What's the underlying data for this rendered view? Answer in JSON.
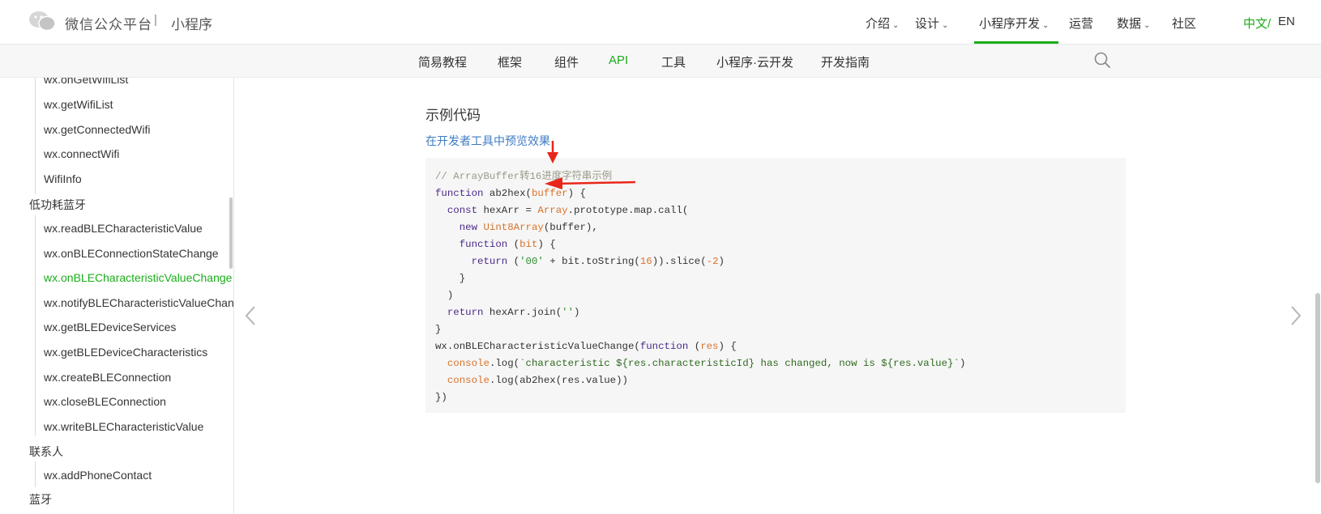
{
  "header": {
    "brand": "微信公众平台",
    "separator": "|",
    "sub": "小程序",
    "nav": [
      {
        "label": "介绍",
        "has_dropdown": true
      },
      {
        "label": "设计",
        "has_dropdown": true
      },
      {
        "label": "小程序开发",
        "has_dropdown": true,
        "active": true
      },
      {
        "label": "运营",
        "has_dropdown": false
      },
      {
        "label": "数据",
        "has_dropdown": true
      },
      {
        "label": "社区",
        "has_dropdown": false
      }
    ],
    "lang_zh": "中文/",
    "lang_en": "EN",
    "accent": "#1aad19"
  },
  "subnav": {
    "items": [
      {
        "label": "简易教程"
      },
      {
        "label": "框架"
      },
      {
        "label": "组件"
      },
      {
        "label": "API",
        "active": true
      },
      {
        "label": "工具"
      },
      {
        "label": "小程序·云开发"
      },
      {
        "label": "开发指南"
      }
    ]
  },
  "sidebar": {
    "items_top": [
      "wx.onGetWifiList",
      "wx.getWifiList",
      "wx.getConnectedWifi",
      "wx.connectWifi",
      "WifiInfo"
    ],
    "category_ble": "低功耗蓝牙",
    "items_ble": [
      "wx.readBLECharacteristicValue",
      "wx.onBLEConnectionStateChange",
      "wx.onBLECharacteristicValueChange",
      "wx.notifyBLECharacteristicValueChange",
      "wx.getBLEDeviceServices",
      "wx.getBLEDeviceCharacteristics",
      "wx.createBLEConnection",
      "wx.closeBLEConnection",
      "wx.writeBLECharacteristicValue"
    ],
    "active_item": "wx.onBLECharacteristicValueChange",
    "category_contact": "联系人",
    "items_contact": [
      "wx.addPhoneContact"
    ],
    "category_next": "蓝牙"
  },
  "main": {
    "section_title": "示例代码",
    "preview_link": "在开发者工具中预览效果",
    "code": {
      "comment": "// ArrayBuffer转16进度字符串示例",
      "l2_kw": "function",
      "l2_name": " ab2hex(",
      "l2_param": "buffer",
      "l2_end": ") {",
      "l3_kw": "const",
      "l3_a": " hexArr = ",
      "l3_bi": "Array",
      "l3_b": ".prototype.map.call(",
      "l4_kw": "new",
      "l4_sp": " ",
      "l4_bi": "Uint8Array",
      "l4_b": "(buffer),",
      "l5_kw": "function",
      "l5_a": " (",
      "l5_param": "bit",
      "l5_b": ") {",
      "l6_kw": "return",
      "l6_a": " (",
      "l6_str": "'00'",
      "l6_b": " + bit.toString(",
      "l6_num": "16",
      "l6_c": ")).slice(",
      "l6_num2": "-2",
      "l6_d": ")",
      "l7": "}",
      "l8": ")",
      "l9_kw": "return",
      "l9_a": " hexArr.join(",
      "l9_str": "''",
      "l9_b": ")",
      "l10": "}",
      "l11_a": "wx.onBLECharacteristicValueChange(",
      "l11_kw": "function",
      "l11_b": " (",
      "l11_param": "res",
      "l11_c": ") {",
      "l12_bi": "console",
      "l12_a": ".log(",
      "l12_tpl": "`characteristic ${res.characteristicId} has changed, now is ${res.value}`",
      "l12_b": ")",
      "l13_bi": "console",
      "l13_a": ".log(ab2hex(res.value))",
      "l14": "})"
    }
  }
}
